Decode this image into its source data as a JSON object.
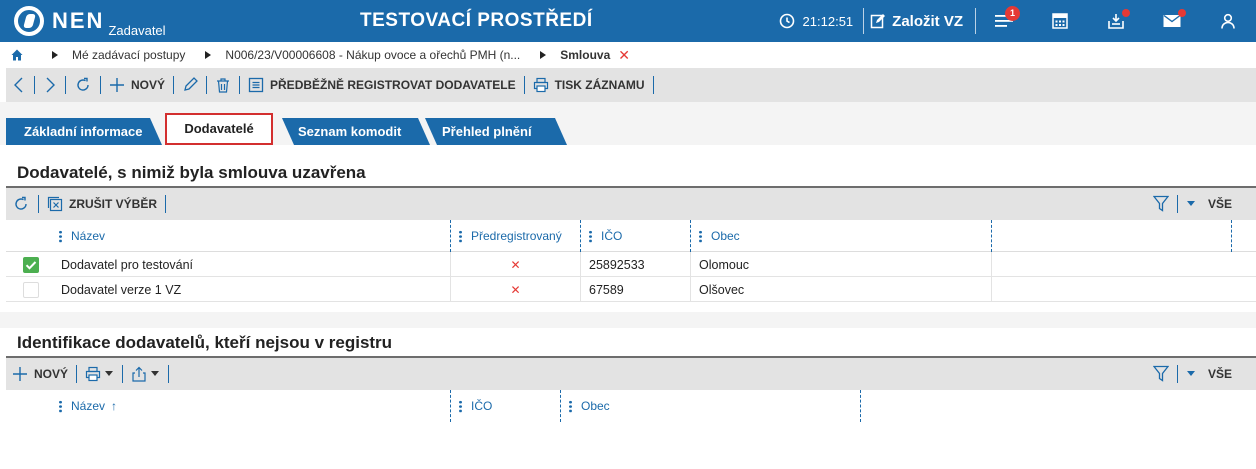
{
  "header": {
    "logo_text": "NEN",
    "logo_sub": "Zadavatel",
    "env_title": "TESTOVACÍ PROSTŘEDÍ",
    "time": "21:12:51",
    "create_label": "Založit VZ",
    "menu_badge": "1"
  },
  "breadcrumb": {
    "items": [
      "Mé zadávací postupy",
      "N006/23/V00006608 - Nákup ovoce a ořechů PMH (n...",
      "Smlouva"
    ],
    "close": "✕"
  },
  "toolbar": {
    "new_label": "NOVÝ",
    "preregister_label": "PŘEDBĚŽNĚ REGISTROVAT DODAVATELE",
    "print_label": "TISK ZÁZNAMU"
  },
  "tabs": [
    {
      "label": "Základní informace",
      "active": false
    },
    {
      "label": "Dodavatelé",
      "active": true
    },
    {
      "label": "Seznam komodit",
      "active": false
    },
    {
      "label": "Přehled plnění",
      "active": false
    }
  ],
  "section1": {
    "title": "Dodavatelé, s nimiž byla smlouva uzavřena",
    "cancel_selection_label": "ZRUŠIT VÝBĚR",
    "all_label": "VŠE",
    "columns": [
      "Název",
      "Předregistrovaný",
      "IČO",
      "Obec"
    ],
    "rows": [
      {
        "checked": true,
        "name": "Dodavatel pro testování",
        "preregistered": "✕",
        "ico": "25892533",
        "city": "Olomouc"
      },
      {
        "checked": false,
        "name": "Dodavatel verze 1 VZ",
        "preregistered": "✕",
        "ico": "67589",
        "city": "Olšovec"
      }
    ]
  },
  "section2": {
    "title": "Identifikace dodavatelů, kteří nejsou v registru",
    "new_label": "NOVÝ",
    "all_label": "VŠE",
    "columns": [
      "Název",
      "IČO",
      "Obec"
    ],
    "sort_indicator": "↑"
  },
  "colors": {
    "brand_blue": "#1b6aaa",
    "tab_blue": "#1b6aaa",
    "accent_red": "#e53935",
    "check_green": "#4caf50",
    "toolbar_gray": "#e3e3e3"
  }
}
